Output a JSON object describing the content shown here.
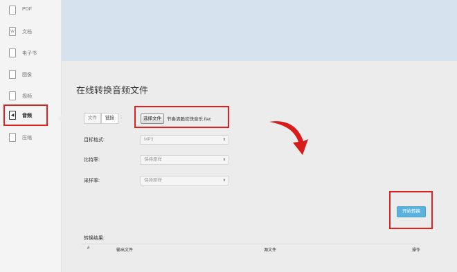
{
  "sidebar": {
    "items": [
      {
        "label": "PDF",
        "icon": "pdf-icon",
        "glyph": "▯"
      },
      {
        "label": "文档",
        "icon": "word-document-icon",
        "glyph": "W"
      },
      {
        "label": "电子书",
        "icon": "ebook-icon",
        "glyph": "▯"
      },
      {
        "label": "图像",
        "icon": "image-icon",
        "glyph": "▯"
      },
      {
        "label": "视频",
        "icon": "video-icon",
        "glyph": "▯"
      },
      {
        "label": "音频",
        "icon": "audio-icon",
        "glyph": "◀"
      },
      {
        "label": "压缩",
        "icon": "archive-icon",
        "glyph": "▯"
      }
    ],
    "active": "音频"
  },
  "page": {
    "title": "在线转换音频文件"
  },
  "source": {
    "tabs": [
      "文件",
      "链接"
    ],
    "colon": ":",
    "choose_file_label": "选择文件",
    "file_name": "节奏清脆欢快音乐.flac"
  },
  "form": {
    "target_format_label": "目标格式:",
    "target_format_value": "MP3",
    "bitrate_label": "比特率:",
    "bitrate_value": "保持原样",
    "samplerate_label": "采样率:",
    "samplerate_value": "保持原样"
  },
  "actions": {
    "start_label": "开始转换"
  },
  "results": {
    "label": "转换结果:",
    "columns": [
      "#",
      "输出文件",
      "源文件",
      "操作"
    ]
  },
  "colors": {
    "highlight": "#e0201e",
    "accent_button": "#5bb3dd",
    "banner": "#d6e3ee",
    "arrow": "#d81c1c"
  }
}
